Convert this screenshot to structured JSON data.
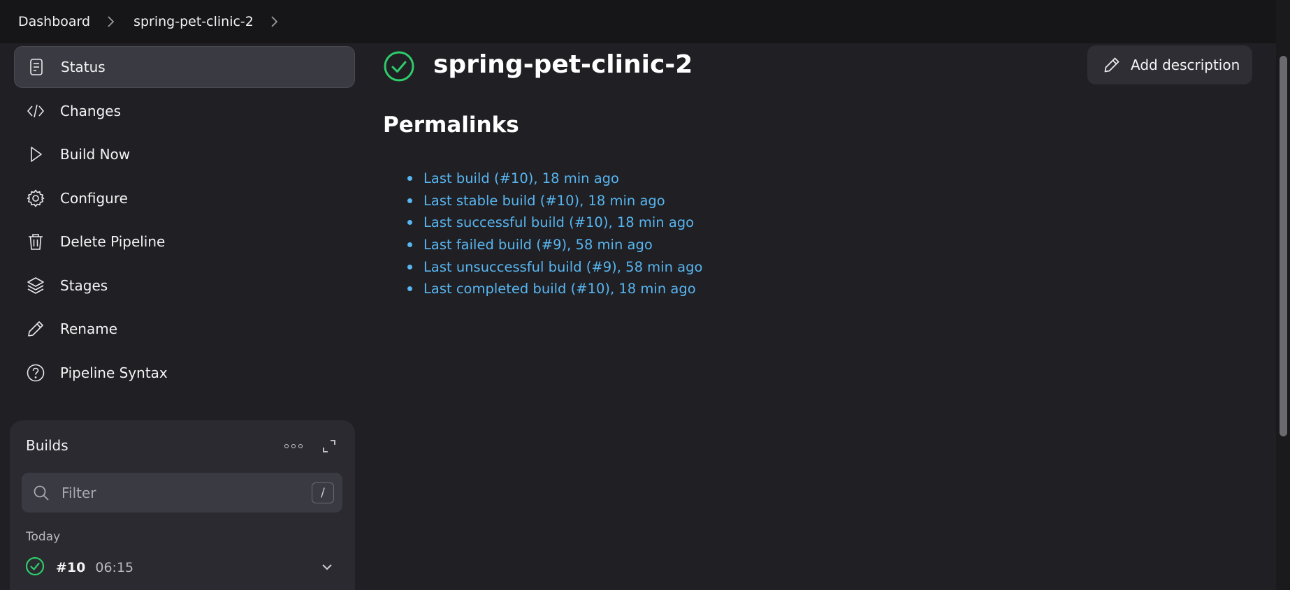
{
  "breadcrumb": {
    "items": [
      "Dashboard",
      "spring-pet-clinic-2"
    ]
  },
  "sidebar": {
    "items": [
      {
        "label": "Status",
        "icon": "document-icon"
      },
      {
        "label": "Changes",
        "icon": "code-icon"
      },
      {
        "label": "Build Now",
        "icon": "play-icon"
      },
      {
        "label": "Configure",
        "icon": "gear-icon"
      },
      {
        "label": "Delete Pipeline",
        "icon": "trash-icon"
      },
      {
        "label": "Stages",
        "icon": "layers-icon"
      },
      {
        "label": "Rename",
        "icon": "pencil-icon"
      },
      {
        "label": "Pipeline Syntax",
        "icon": "help-icon"
      }
    ]
  },
  "builds": {
    "title": "Builds",
    "filter_placeholder": "Filter",
    "filter_shortcut": "/",
    "group_label": "Today",
    "rows": [
      {
        "number": "#10",
        "time": "06:15",
        "status": "success"
      }
    ]
  },
  "main": {
    "title": "spring-pet-clinic-2",
    "add_description_label": "Add description",
    "permalinks_title": "Permalinks",
    "permalinks": [
      "Last build (#10), 18 min ago",
      "Last stable build (#10), 18 min ago",
      "Last successful build (#10), 18 min ago",
      "Last failed build (#9), 58 min ago",
      "Last unsuccessful build (#9), 58 min ago",
      "Last completed build (#10), 18 min ago"
    ]
  },
  "colors": {
    "background": "#1f1f24",
    "topbar": "#161618",
    "link": "#58b6f0",
    "success": "#2fcb6b",
    "active_item": "#3a3a42"
  }
}
